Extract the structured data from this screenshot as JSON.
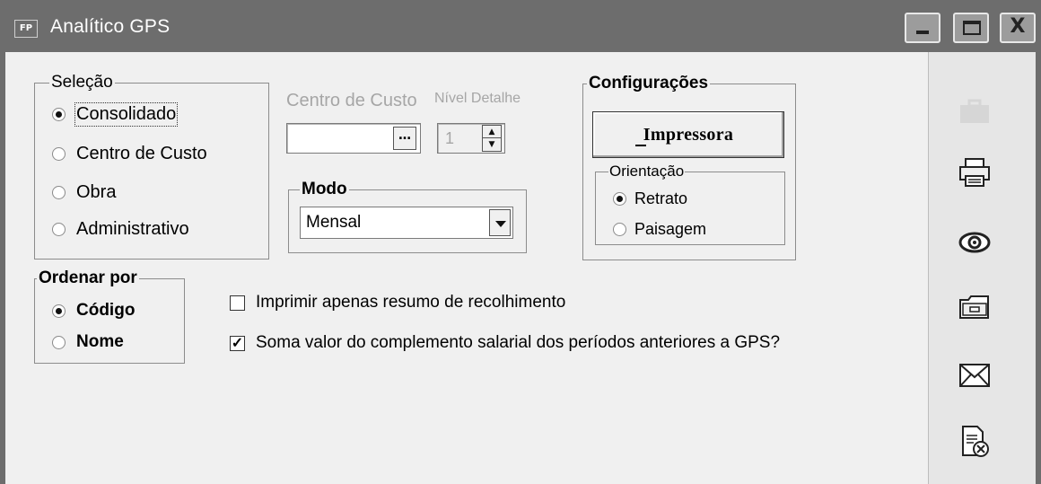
{
  "window": {
    "icon_text": "FP",
    "title": "Analítico GPS",
    "controls": {
      "minimize": "_",
      "maximize": "□",
      "close": "X"
    }
  },
  "selecao": {
    "legend": "Seleção",
    "options": [
      {
        "label": "Consolidado",
        "selected": true
      },
      {
        "label": "Centro de Custo",
        "selected": false
      },
      {
        "label": "Obra",
        "selected": false
      },
      {
        "label": "Administrativo",
        "selected": false
      }
    ]
  },
  "centro_custo": {
    "label": "Centro de Custo",
    "value": "",
    "button": "…"
  },
  "nivel_detalhe": {
    "label": "Nível Detalhe",
    "value": "1"
  },
  "modo": {
    "legend": "Modo",
    "selected": "Mensal"
  },
  "configuracoes": {
    "legend": "Configurações",
    "printer_button": "Impressora",
    "orientacao": {
      "legend": "Orientação",
      "options": [
        {
          "label": "Retrato",
          "selected": true
        },
        {
          "label": "Paisagem",
          "selected": false
        }
      ]
    }
  },
  "ordenar": {
    "legend": "Ordenar por",
    "options": [
      {
        "label": "Código",
        "selected": true
      },
      {
        "label": "Nome",
        "selected": false
      }
    ]
  },
  "checkboxes": [
    {
      "label": "Imprimir apenas resumo de recolhimento",
      "checked": false
    },
    {
      "label": "Soma valor do complemento salarial dos períodos anteriores a GPS?",
      "checked": true
    }
  ],
  "toolbar": {
    "icons": [
      "briefcase-icon",
      "printer-icon",
      "eye-icon",
      "folder-icon",
      "envelope-icon",
      "document-cancel-icon"
    ]
  },
  "check_mark": "✓"
}
